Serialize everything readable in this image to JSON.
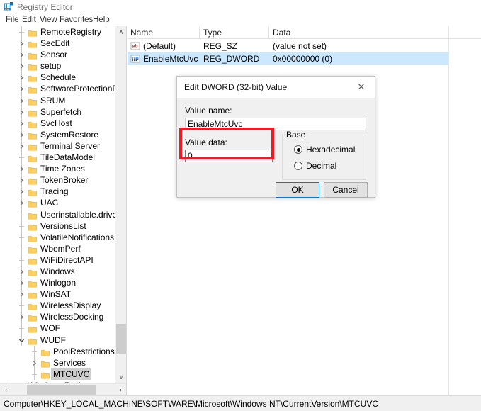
{
  "window": {
    "title": "Registry Editor",
    "icon": "registry-editor-icon"
  },
  "menubar": {
    "items": [
      {
        "label": "File"
      },
      {
        "label": "Edit"
      },
      {
        "label": "View"
      },
      {
        "label": "Favorites"
      },
      {
        "label": "Help"
      }
    ]
  },
  "tree": {
    "nodes": [
      {
        "label": "RemoteRegistry",
        "indent": 1,
        "expander": "none",
        "selected": false
      },
      {
        "label": "SecEdit",
        "indent": 1,
        "expander": "collapsed",
        "selected": false
      },
      {
        "label": "Sensor",
        "indent": 1,
        "expander": "collapsed",
        "selected": false
      },
      {
        "label": "setup",
        "indent": 1,
        "expander": "collapsed",
        "selected": false
      },
      {
        "label": "Schedule",
        "indent": 1,
        "expander": "collapsed",
        "selected": false
      },
      {
        "label": "SoftwareProtectionPl",
        "indent": 1,
        "expander": "collapsed",
        "selected": false
      },
      {
        "label": "SRUM",
        "indent": 1,
        "expander": "collapsed",
        "selected": false
      },
      {
        "label": "Superfetch",
        "indent": 1,
        "expander": "collapsed",
        "selected": false
      },
      {
        "label": "SvcHost",
        "indent": 1,
        "expander": "collapsed",
        "selected": false
      },
      {
        "label": "SystemRestore",
        "indent": 1,
        "expander": "collapsed",
        "selected": false
      },
      {
        "label": "Terminal Server",
        "indent": 1,
        "expander": "collapsed",
        "selected": false
      },
      {
        "label": "TileDataModel",
        "indent": 1,
        "expander": "none",
        "selected": false
      },
      {
        "label": "Time Zones",
        "indent": 1,
        "expander": "collapsed",
        "selected": false
      },
      {
        "label": "TokenBroker",
        "indent": 1,
        "expander": "collapsed",
        "selected": false
      },
      {
        "label": "Tracing",
        "indent": 1,
        "expander": "collapsed",
        "selected": false
      },
      {
        "label": "UAC",
        "indent": 1,
        "expander": "collapsed",
        "selected": false
      },
      {
        "label": "Userinstallable.driver",
        "indent": 1,
        "expander": "none",
        "selected": false
      },
      {
        "label": "VersionsList",
        "indent": 1,
        "expander": "none",
        "selected": false
      },
      {
        "label": "VolatileNotifications",
        "indent": 1,
        "expander": "none",
        "selected": false
      },
      {
        "label": "WbemPerf",
        "indent": 1,
        "expander": "none",
        "selected": false
      },
      {
        "label": "WiFiDirectAPI",
        "indent": 1,
        "expander": "none",
        "selected": false
      },
      {
        "label": "Windows",
        "indent": 1,
        "expander": "collapsed",
        "selected": false
      },
      {
        "label": "Winlogon",
        "indent": 1,
        "expander": "collapsed",
        "selected": false
      },
      {
        "label": "WinSAT",
        "indent": 1,
        "expander": "collapsed",
        "selected": false
      },
      {
        "label": "WirelessDisplay",
        "indent": 1,
        "expander": "none",
        "selected": false
      },
      {
        "label": "WirelessDocking",
        "indent": 1,
        "expander": "collapsed",
        "selected": false
      },
      {
        "label": "WOF",
        "indent": 1,
        "expander": "none",
        "selected": false
      },
      {
        "label": "WUDF",
        "indent": 1,
        "expander": "expanded",
        "selected": false
      },
      {
        "label": "PoolRestrictions",
        "indent": 2,
        "expander": "none",
        "selected": false
      },
      {
        "label": "Services",
        "indent": 2,
        "expander": "collapsed",
        "selected": false
      },
      {
        "label": "MTCUVC",
        "indent": 2,
        "expander": "none",
        "selected": true
      },
      {
        "label": "Windows Performance Tool",
        "indent": 0,
        "expander": "collapsed",
        "selected": false
      }
    ]
  },
  "listview": {
    "columns": [
      "Name",
      "Type",
      "Data"
    ],
    "rows": [
      {
        "icon": "string-value-icon",
        "name": "(Default)",
        "type": "REG_SZ",
        "data": "(value not set)",
        "selected": false
      },
      {
        "icon": "dword-value-icon",
        "name": "EnableMtcUvc",
        "type": "REG_DWORD",
        "data": "0x00000000 (0)",
        "selected": true
      }
    ]
  },
  "statusbar": {
    "path": "Computer\\HKEY_LOCAL_MACHINE\\SOFTWARE\\Microsoft\\Windows NT\\CurrentVersion\\MTCUVC"
  },
  "dialog": {
    "title": "Edit DWORD (32-bit) Value",
    "close_label": "✕",
    "value_name_label": "Value name:",
    "value_name": "EnableMtcUvc",
    "value_data_label": "Value data:",
    "value_data": "0",
    "base_label": "Base",
    "base_options": [
      {
        "label": "Hexadecimal",
        "selected": true
      },
      {
        "label": "Decimal",
        "selected": false
      }
    ],
    "ok_label": "OK",
    "cancel_label": "Cancel"
  },
  "annotation": {
    "highlight_color": "#ed1c24"
  },
  "scrollbars": {
    "tree_vertical": {
      "up": "∧",
      "down": "∨"
    },
    "tree_horizontal": {
      "left": "‹",
      "right": "›"
    }
  }
}
